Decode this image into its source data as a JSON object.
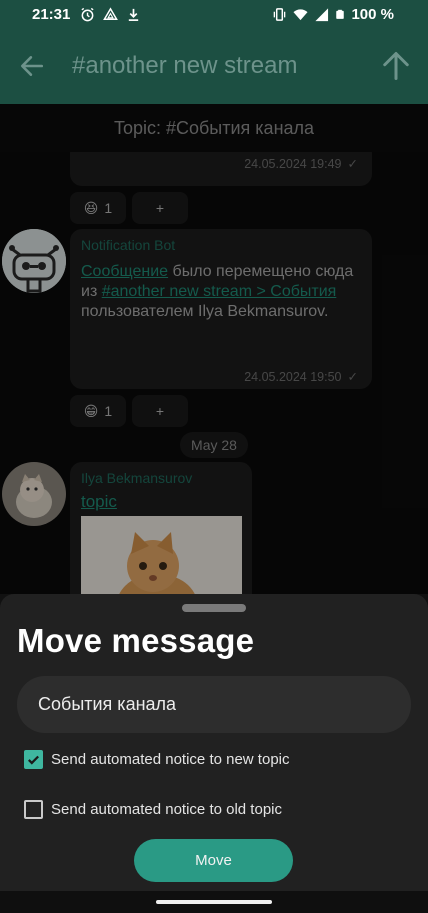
{
  "status_bar": {
    "time": "21:31",
    "battery": "100 %",
    "icons": [
      "alarm-icon",
      "drive-icon",
      "download-icon",
      "vibrate-icon",
      "wifi-icon",
      "signal-icon",
      "battery-icon"
    ]
  },
  "app_bar": {
    "title": "#another new stream",
    "back_icon": "arrow-left-icon",
    "up_icon": "arrow-up-icon"
  },
  "topic_bar": {
    "label": "Topic: #События канала"
  },
  "messages": [
    {
      "timestamp": "24.05.2024 19:49",
      "reactions": [
        {
          "emoji": "😆",
          "count": "1"
        },
        {
          "emoji": "",
          "count": "+"
        }
      ]
    },
    {
      "sender": "Notification Bot",
      "link1": "Сообщение",
      "text1": " было перемещено сюда из ",
      "link2": "#another new stream > События",
      "text2": " пользователем Ilya Bekmansurov.",
      "timestamp": "24.05.2024 19:50",
      "reactions": [
        {
          "emoji": "😁",
          "count": "1"
        },
        {
          "emoji": "",
          "count": "+"
        }
      ]
    },
    {
      "sender": "Ilya Bekmansurov",
      "link": "topic"
    }
  ],
  "date_divider": "May 28",
  "sheet": {
    "title": "Move message",
    "topic_value": "События канала",
    "notice_new_label": "Send automated notice to new topic",
    "notice_new_checked": true,
    "notice_old_label": "Send automated notice to old topic",
    "notice_old_checked": false,
    "move_label": "Move"
  },
  "colors": {
    "app_bar": "#1c4f42",
    "accent": "#2a9a85",
    "sheet_bg": "#212121"
  }
}
